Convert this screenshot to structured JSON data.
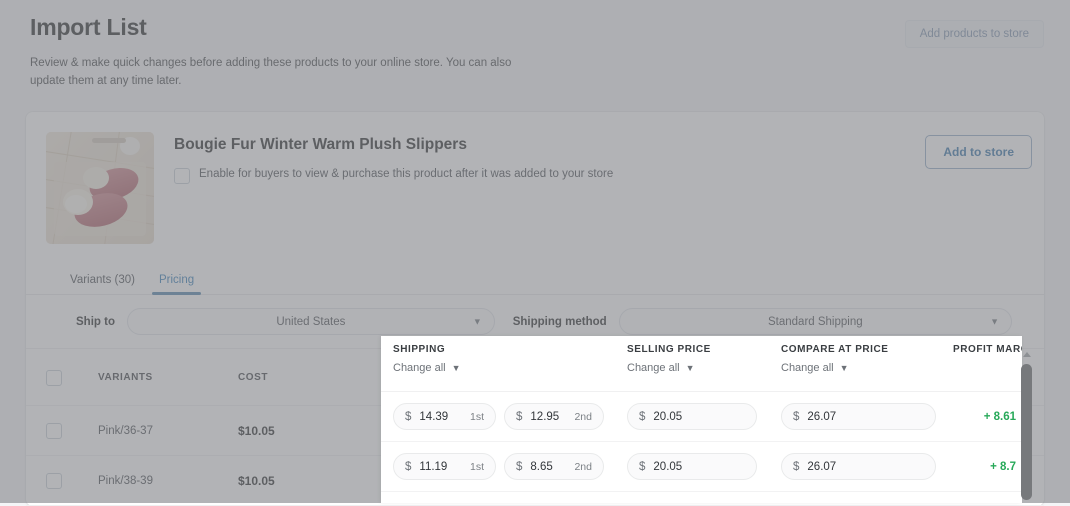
{
  "header": {
    "title": "Import List",
    "subtitle": "Review & make quick changes before adding these products to your online store. You can also update them at any time later.",
    "add_products_label": "Add products to store"
  },
  "product": {
    "name": "Bougie Fur Winter Warm Plush Slippers",
    "enable_label": "Enable for buyers to view & purchase this product after it was added to your store",
    "add_to_store_label": "Add to store",
    "image_alt": "pink plush slippers on wooden floor"
  },
  "tabs": [
    {
      "label": "Variants (30)",
      "active": false
    },
    {
      "label": "Pricing",
      "active": true
    }
  ],
  "shipping_controls": {
    "ship_to_label": "Ship to",
    "ship_to_value": "United States",
    "shipping_method_label": "Shipping method",
    "shipping_method_value": "Standard Shipping",
    "caret": "chevron-down"
  },
  "table": {
    "headers": {
      "variants": "VARIANTS",
      "cost": "COST",
      "shipping": "SHIPPING",
      "selling_price": "SELLING PRICE",
      "compare_at_price": "COMPARE AT PRICE",
      "profit_margin": "PROFIT MARGIN"
    },
    "change_all_label": "Change all",
    "currency": "$",
    "rows": [
      {
        "variant": "Pink/36-37",
        "cost": "$10.05",
        "shipping_first": "14.39",
        "shipping_first_order": "1st",
        "shipping_second": "12.95",
        "shipping_second_order": "2nd",
        "selling_price": "20.05",
        "compare_at_price": "26.07",
        "profit_margin": "+ 8.61"
      },
      {
        "variant": "Pink/38-39",
        "cost": "$10.05",
        "shipping_first": "11.19",
        "shipping_first_order": "1st",
        "shipping_second": "8.65",
        "shipping_second_order": "2nd",
        "selling_price": "20.05",
        "compare_at_price": "26.07",
        "profit_margin": "+ 8.7"
      }
    ]
  },
  "colors": {
    "accent_blue": "#2f7ab5",
    "profit_green": "#27a959",
    "page_bg": "#f4f5f7",
    "text_dark": "#202223"
  }
}
